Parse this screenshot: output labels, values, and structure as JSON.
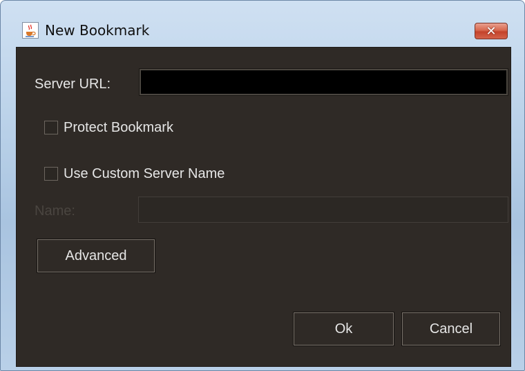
{
  "window": {
    "title": "New Bookmark",
    "close_label": "✕"
  },
  "form": {
    "server_url_label": "Server URL:",
    "server_url_value": "",
    "protect_bookmark_label": "Protect Bookmark",
    "protect_bookmark_checked": false,
    "custom_name_label": "Use Custom Server Name",
    "custom_name_checked": false,
    "name_label": "Name:",
    "name_value": ""
  },
  "buttons": {
    "advanced": "Advanced",
    "ok": "Ok",
    "cancel": "Cancel"
  },
  "colors": {
    "client_background": "#2f2a26",
    "text": "#e6e6e6",
    "disabled_text": "#4a4540",
    "close_button": "#c4432b"
  },
  "icons": {
    "app": "java-coffee-cup-icon",
    "close": "close-icon"
  }
}
